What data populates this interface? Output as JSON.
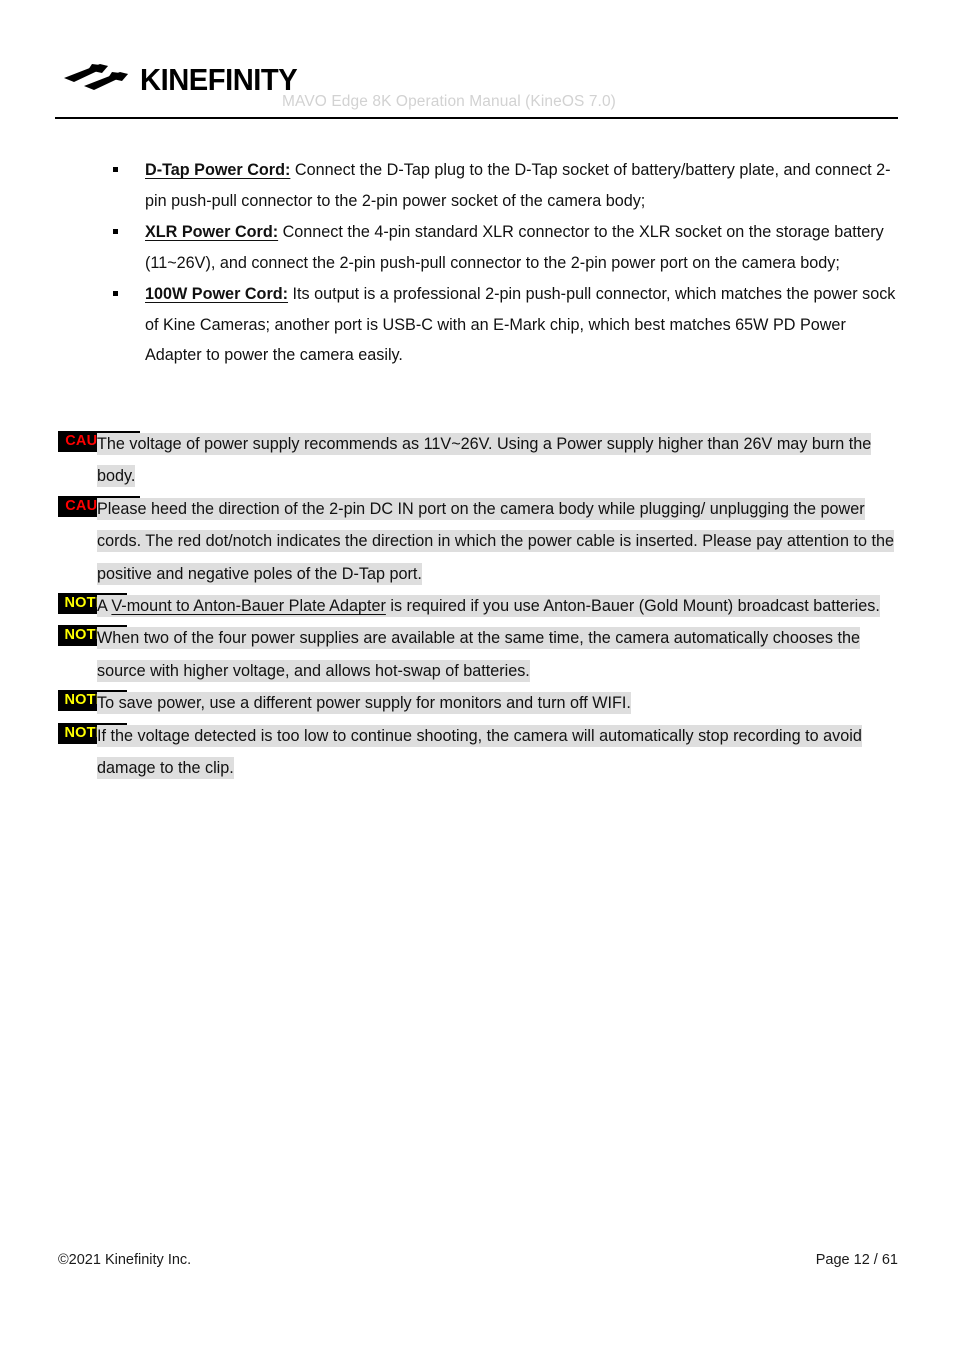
{
  "header": {
    "logo_word": "KINEFINITY",
    "logo_mark_name": "kinefinity-logo-mark",
    "title": "MAVO Edge 8K Operation Manual (KineOS 7.0)"
  },
  "bullets": [
    {
      "lead": "D-Tap Power Cord:",
      "body": " Connect the D-Tap plug to the D-Tap socket of battery/battery plate, and connect 2-pin push-pull connector to the 2-pin power socket of the camera body;"
    },
    {
      "lead": "XLR Power Cord:",
      "body": " Connect the 4-pin standard XLR connector to the XLR socket on the storage battery (11~26V), and connect the 2-pin push-pull connector to the 2-pin power port on the camera body;"
    },
    {
      "lead": "100W Power Cord:",
      "body": " Its output is a professional 2-pin push-pull connector, which matches the power sock of Kine Cameras; another port is USB-C with an E-Mark chip, which best matches 65W PD Power Adapter to power the camera easily."
    }
  ],
  "notes": [
    {
      "badge": "CAUTION",
      "kind": "caution",
      "text": "The voltage of power supply recommends as 11V~26V. Using a Power supply higher than 26V may burn the body."
    },
    {
      "badge": "CAUTION",
      "kind": "caution",
      "text": "Please heed the direction of the 2-pin DC IN port on the camera body while plugging/ unplugging the power cords. The red dot/notch indicates the direction in which the power cable is inserted. Please pay attention to the positive and negative poles of the D-Tap port."
    },
    {
      "badge": "NOTICE",
      "kind": "notice",
      "text_before": "A ",
      "link": "V-mount to Anton-Bauer Plate Adapter",
      "text_after": " is required if you use Anton-Bauer (Gold Mount) broadcast batteries."
    },
    {
      "badge": "NOTICE",
      "kind": "notice",
      "text": "When two of the four power supplies are available at the same time, the camera automatically chooses the source with higher voltage, and allows hot-swap of batteries."
    },
    {
      "badge": "NOTICE",
      "kind": "notice",
      "text": "To save power, use a different power supply for monitors and turn off WIFI."
    },
    {
      "badge": "NOTICE",
      "kind": "notice",
      "text": "If the voltage detected is too low to continue shooting, the camera will automatically stop recording to avoid damage to the clip."
    }
  ],
  "footer": {
    "copyright": "©2021 Kinefinity Inc.",
    "page": "Page 12 / 61"
  },
  "colors": {
    "caution_text": "#ff0000",
    "notice_text": "#ffff00",
    "badge_bg": "#000000",
    "highlight": "#dedede",
    "header_title": "#d2d2d2"
  }
}
